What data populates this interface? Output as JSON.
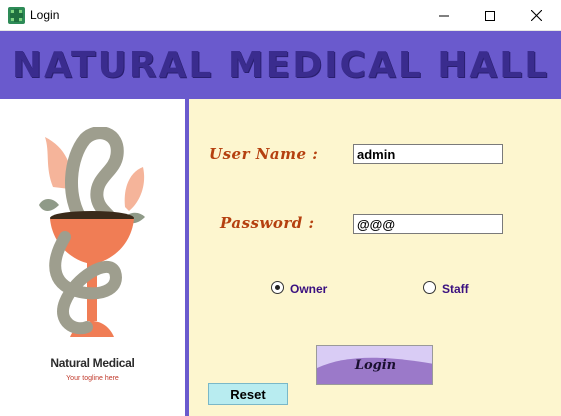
{
  "window": {
    "title": "Login",
    "controls": [
      "minimize-icon",
      "maximize-icon",
      "close-icon"
    ]
  },
  "banner": {
    "title": "NATURAL MEDICAL HALL"
  },
  "logo": {
    "name": "Natural Medical",
    "tagline": "Your togline here",
    "icon": "snake-bowl-icon"
  },
  "form": {
    "username": {
      "label": "User Name :",
      "value": "admin"
    },
    "password": {
      "label": "Password :",
      "value": "@@@"
    },
    "role": {
      "options": [
        {
          "label": "Owner",
          "checked": true
        },
        {
          "label": "Staff",
          "checked": false
        }
      ]
    },
    "login_label": "Login",
    "reset_label": "Reset"
  },
  "colors": {
    "banner": "#6a5acd",
    "form_background": "#fdf6cf",
    "label": "#b5400f",
    "radio_label": "#3a1080",
    "reset_button": "#b8ecf0"
  }
}
